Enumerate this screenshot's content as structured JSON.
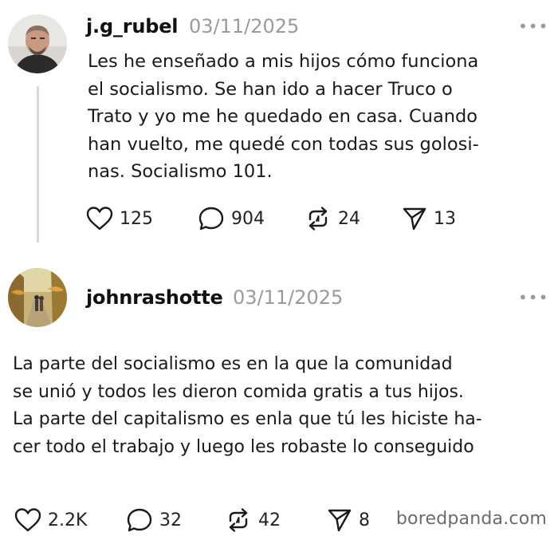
{
  "posts": [
    {
      "username": "j.g_rubel",
      "date": "03/11/2025",
      "more": "•••",
      "text": "Les he enseñado a mis hijos cómo funciona\nel socialismo. Se han ido a hacer Truco o\nTrato y yo me he quedado en casa. Cuando\nhan vuelto, me quedé con todas sus golosi-\nnas. Socialismo 101.",
      "likes": "125",
      "comments": "904",
      "reposts": "24",
      "shares": "13"
    },
    {
      "username": "johnrashotte",
      "date": "03/11/2025",
      "more": "•••",
      "text": "La parte del socialismo es en la que la comunidad\nse unió y todos les dieron comida gratis a tus hijos.\nLa parte del capitalismo es enla que tú les hiciste ha-\ncer todo el trabajo y luego les robaste lo conseguido",
      "likes": "2.2K",
      "comments": "32",
      "reposts": "42",
      "shares": "8"
    }
  ],
  "watermark": "boredpanda.com",
  "icons": {
    "like": "heart-icon",
    "comment": "comment-bubble-icon",
    "repost": "repost-icon",
    "share": "send-icon"
  }
}
